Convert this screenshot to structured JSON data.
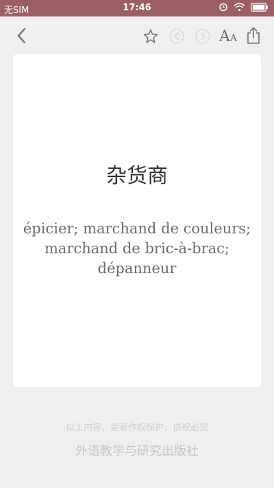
{
  "status_bar": {
    "carrier": "无SIM",
    "time": "17:46",
    "background_color": "#9b5e62",
    "icons": [
      "alarm-icon",
      "wifi-icon",
      "battery-icon"
    ]
  },
  "toolbar": {
    "back_icon": "chevron-left-icon",
    "favorite_icon": "star-icon",
    "prev_icon": "circle-arrow-left-icon",
    "next_icon": "circle-arrow-right-icon",
    "font_label": "AA",
    "share_icon": "share-icon"
  },
  "card": {
    "headword": "杂货商",
    "definition": "épicier; marchand de couleurs; marchand de bric-à-brac; dépanneur"
  },
  "footer": {
    "copyright": "以上内容，受著作权保护，侵权必究",
    "publisher": "外语教学与研究出版社"
  }
}
